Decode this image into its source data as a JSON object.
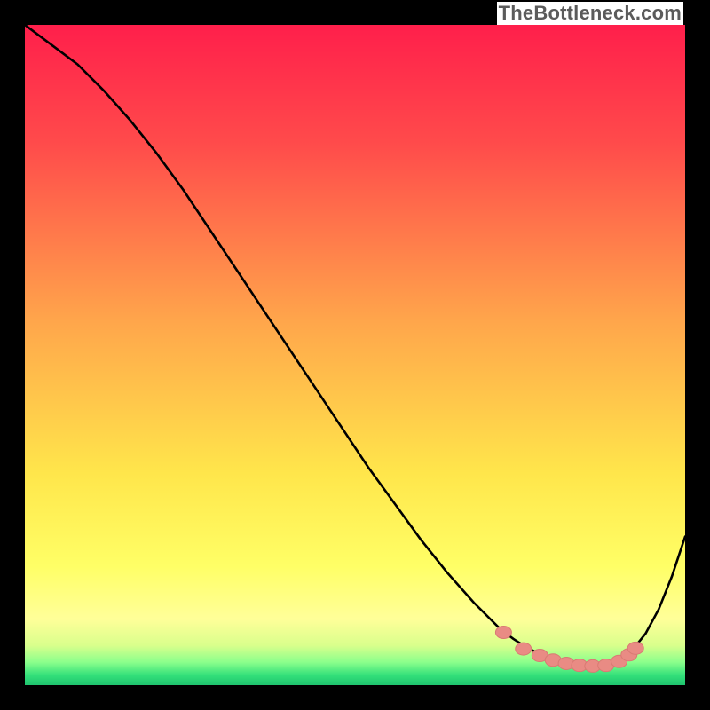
{
  "watermark": "TheBottleneck.com",
  "colors": {
    "border": "#000000",
    "gradient_stops": [
      {
        "offset": 0.0,
        "color": "#ff1f4b"
      },
      {
        "offset": 0.18,
        "color": "#ff4b4b"
      },
      {
        "offset": 0.45,
        "color": "#ffa64b"
      },
      {
        "offset": 0.68,
        "color": "#ffe64b"
      },
      {
        "offset": 0.82,
        "color": "#ffff66"
      },
      {
        "offset": 0.9,
        "color": "#ffff99"
      },
      {
        "offset": 0.94,
        "color": "#d9ff8c"
      },
      {
        "offset": 0.965,
        "color": "#8cff8c"
      },
      {
        "offset": 0.985,
        "color": "#33e07a"
      },
      {
        "offset": 1.0,
        "color": "#1fc46f"
      }
    ],
    "curve": "#000000",
    "marker_fill": "#e98b84",
    "marker_stroke": "#d97a73"
  },
  "chart_data": {
    "type": "line",
    "title": "",
    "xlabel": "",
    "ylabel": "",
    "xlim": [
      0,
      100
    ],
    "ylim": [
      0,
      100
    ],
    "series": [
      {
        "name": "bottleneck-curve",
        "x": [
          0,
          4,
          8,
          12,
          16,
          20,
          24,
          28,
          32,
          36,
          40,
          44,
          48,
          52,
          56,
          60,
          64,
          68,
          72,
          74,
          76,
          78,
          80,
          82,
          84,
          86,
          88,
          90,
          92,
          94,
          96,
          98,
          100
        ],
        "y": [
          100,
          97,
          94,
          90,
          85.5,
          80.5,
          75,
          69,
          63,
          57,
          51,
          45,
          39,
          33,
          27.5,
          22,
          17,
          12.5,
          8.5,
          7,
          5.7,
          4.7,
          3.9,
          3.3,
          3.0,
          2.9,
          3.1,
          3.9,
          5.3,
          7.8,
          11.5,
          16.5,
          22.5
        ]
      }
    ],
    "markers": {
      "name": "highlight-dots",
      "x": [
        72.5,
        75.5,
        78.0,
        80.0,
        82.0,
        84.0,
        86.0,
        88.0,
        90.0,
        91.5,
        92.5
      ],
      "y": [
        8.0,
        5.5,
        4.5,
        3.8,
        3.3,
        3.0,
        2.9,
        3.0,
        3.6,
        4.6,
        5.6
      ]
    }
  }
}
